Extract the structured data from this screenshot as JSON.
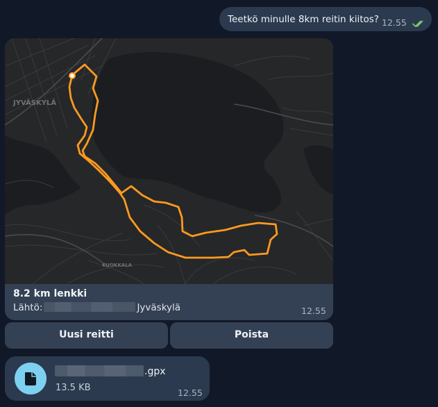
{
  "outgoing": {
    "text": "Teetkö minulle 8km reitin kiitos?",
    "time": "12.55",
    "status_icon": "double-check-icon",
    "status_color": "#7fcf6a"
  },
  "route_card": {
    "map": {
      "labels": [
        "JYVÄSKYLÄ",
        "KUOKKALA"
      ],
      "route_color": "#ff9a1f"
    },
    "title": "8.2 km lenkki",
    "start_label": "Lähtö:",
    "start_city": "Jyväskylä",
    "time": "12.55"
  },
  "buttons": {
    "new_route": "Uusi reitti",
    "delete": "Poista"
  },
  "file": {
    "icon": "document-icon",
    "extension": ".gpx",
    "size": "13.5 KB",
    "time": "12.55"
  }
}
